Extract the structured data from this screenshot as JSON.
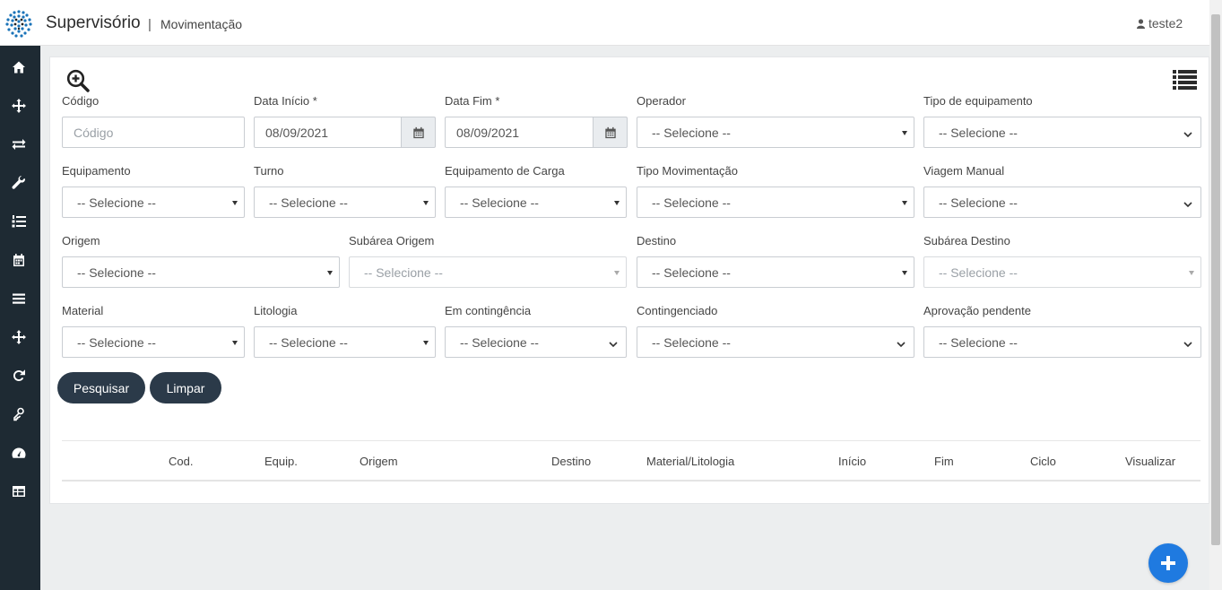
{
  "header": {
    "app_title": "Supervisório",
    "separator": "|",
    "page_title": "Movimentação",
    "user_name": "teste2"
  },
  "sidebar": {
    "icons": [
      "home-icon",
      "crosshair-icon",
      "exchange-icon",
      "wrench-icon",
      "list-ol-icon",
      "calendar-icon",
      "menu-icon",
      "crosshair-icon",
      "refresh-icon",
      "key-icon",
      "dashboard-icon",
      "table-icon"
    ]
  },
  "filters": {
    "codigo": {
      "label": "Código",
      "placeholder": "Código"
    },
    "data_inicio": {
      "label": "Data Início *",
      "value": "08/09/2021"
    },
    "data_fim": {
      "label": "Data Fim *",
      "value": "08/09/2021"
    },
    "operador": {
      "label": "Operador",
      "value": "-- Selecione --"
    },
    "tipo_equipamento": {
      "label": "Tipo de equipamento",
      "value": "-- Selecione --"
    },
    "equipamento": {
      "label": "Equipamento",
      "value": "-- Selecione --"
    },
    "turno": {
      "label": "Turno",
      "value": "-- Selecione --"
    },
    "equipamento_carga": {
      "label": "Equipamento de Carga",
      "value": "-- Selecione --"
    },
    "tipo_movimentacao": {
      "label": "Tipo Movimentação",
      "value": "-- Selecione --"
    },
    "viagem_manual": {
      "label": "Viagem Manual",
      "value": "-- Selecione --"
    },
    "origem": {
      "label": "Origem",
      "value": "-- Selecione --"
    },
    "subarea_origem": {
      "label": "Subárea Origem",
      "value": "-- Selecione --"
    },
    "destino": {
      "label": "Destino",
      "value": "-- Selecione --"
    },
    "subarea_destino": {
      "label": "Subárea Destino",
      "value": "-- Selecione --"
    },
    "material": {
      "label": "Material",
      "value": "-- Selecione --"
    },
    "litologia": {
      "label": "Litologia",
      "value": "-- Selecione --"
    },
    "em_contingencia": {
      "label": "Em contingência",
      "value": "-- Selecione --"
    },
    "contingenciado": {
      "label": "Contingenciado",
      "value": "-- Selecione --"
    },
    "aprovacao_pendente": {
      "label": "Aprovação pendente",
      "value": "-- Selecione --"
    }
  },
  "actions": {
    "search": "Pesquisar",
    "clear": "Limpar"
  },
  "table": {
    "columns": [
      "Cod.",
      "Equip.",
      "Origem",
      "Destino",
      "Material/Litologia",
      "Início",
      "Fim",
      "Ciclo",
      "Visualizar"
    ]
  },
  "colors": {
    "sidebar": "#1e2a33",
    "button": "#2b3a49",
    "fab": "#1f7ae0"
  }
}
